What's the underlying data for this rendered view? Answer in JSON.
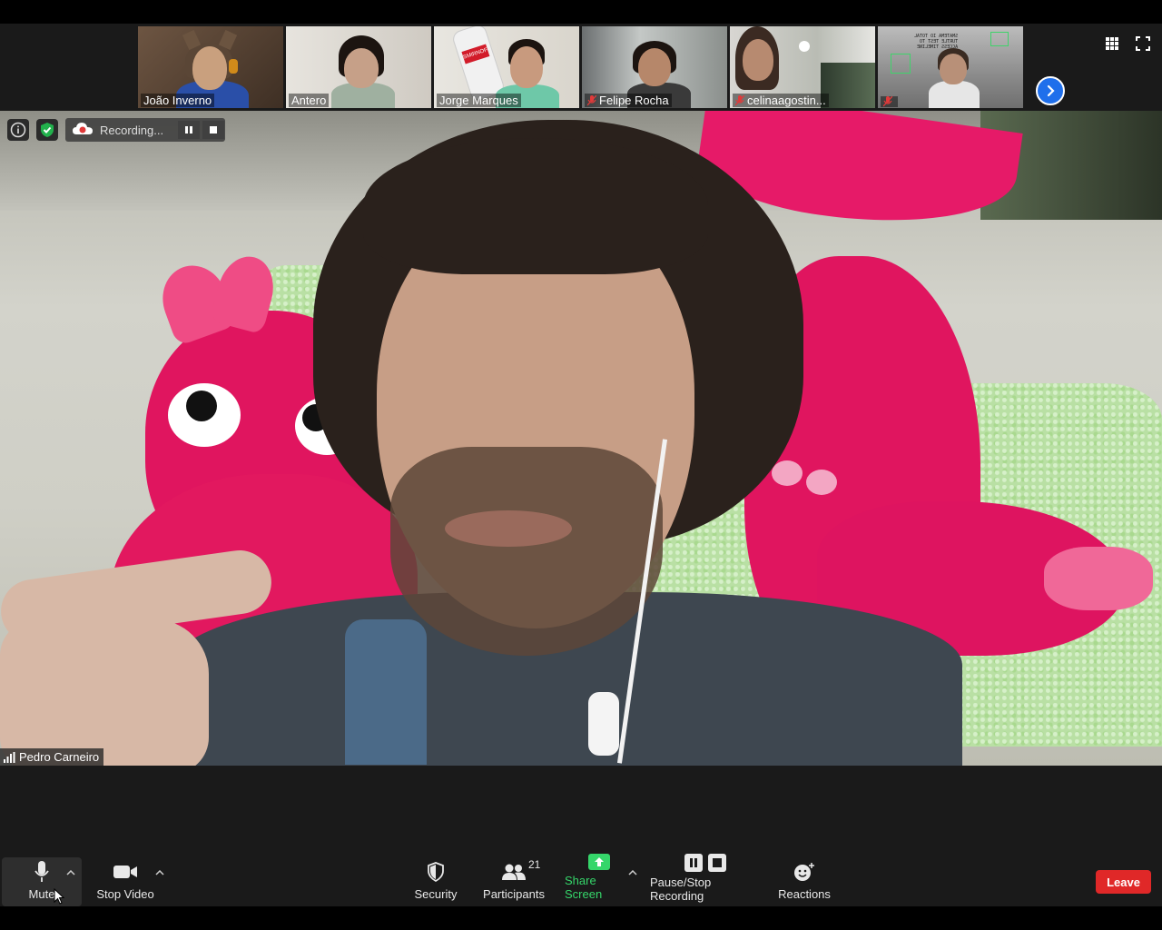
{
  "thumbnails": [
    {
      "name": "João Inverno",
      "muted": false
    },
    {
      "name": "Antero",
      "muted": false
    },
    {
      "name": "Jorge Marques",
      "muted": false
    },
    {
      "name": "Felipe Rocha",
      "muted": true
    },
    {
      "name": "celinaagostin...",
      "muted": true
    },
    {
      "name": "",
      "muted": true
    }
  ],
  "thumbnail_extra_text": {
    "bottle_label": "SMIRNOFF",
    "sign_text": "SMATEMA IO TOTAL\nTURTLE TEST TO\nACCESS TIMELINE"
  },
  "recording": {
    "label": "Recording..."
  },
  "active_speaker": {
    "name": "Pedro Carneiro"
  },
  "toolbar": {
    "mute_label": "Mute",
    "video_label": "Stop Video",
    "security_label": "Security",
    "participants_label": "Participants",
    "participants_count": "21",
    "share_label": "Share Screen",
    "recording_label": "Pause/Stop Recording",
    "reactions_label": "Reactions",
    "leave_label": "Leave"
  },
  "colors": {
    "accent_blue": "#1f6feb",
    "share_green": "#35d66a",
    "leave_red": "#e02828",
    "recording_red": "#e03a3a",
    "shield_green": "#22b14c"
  }
}
